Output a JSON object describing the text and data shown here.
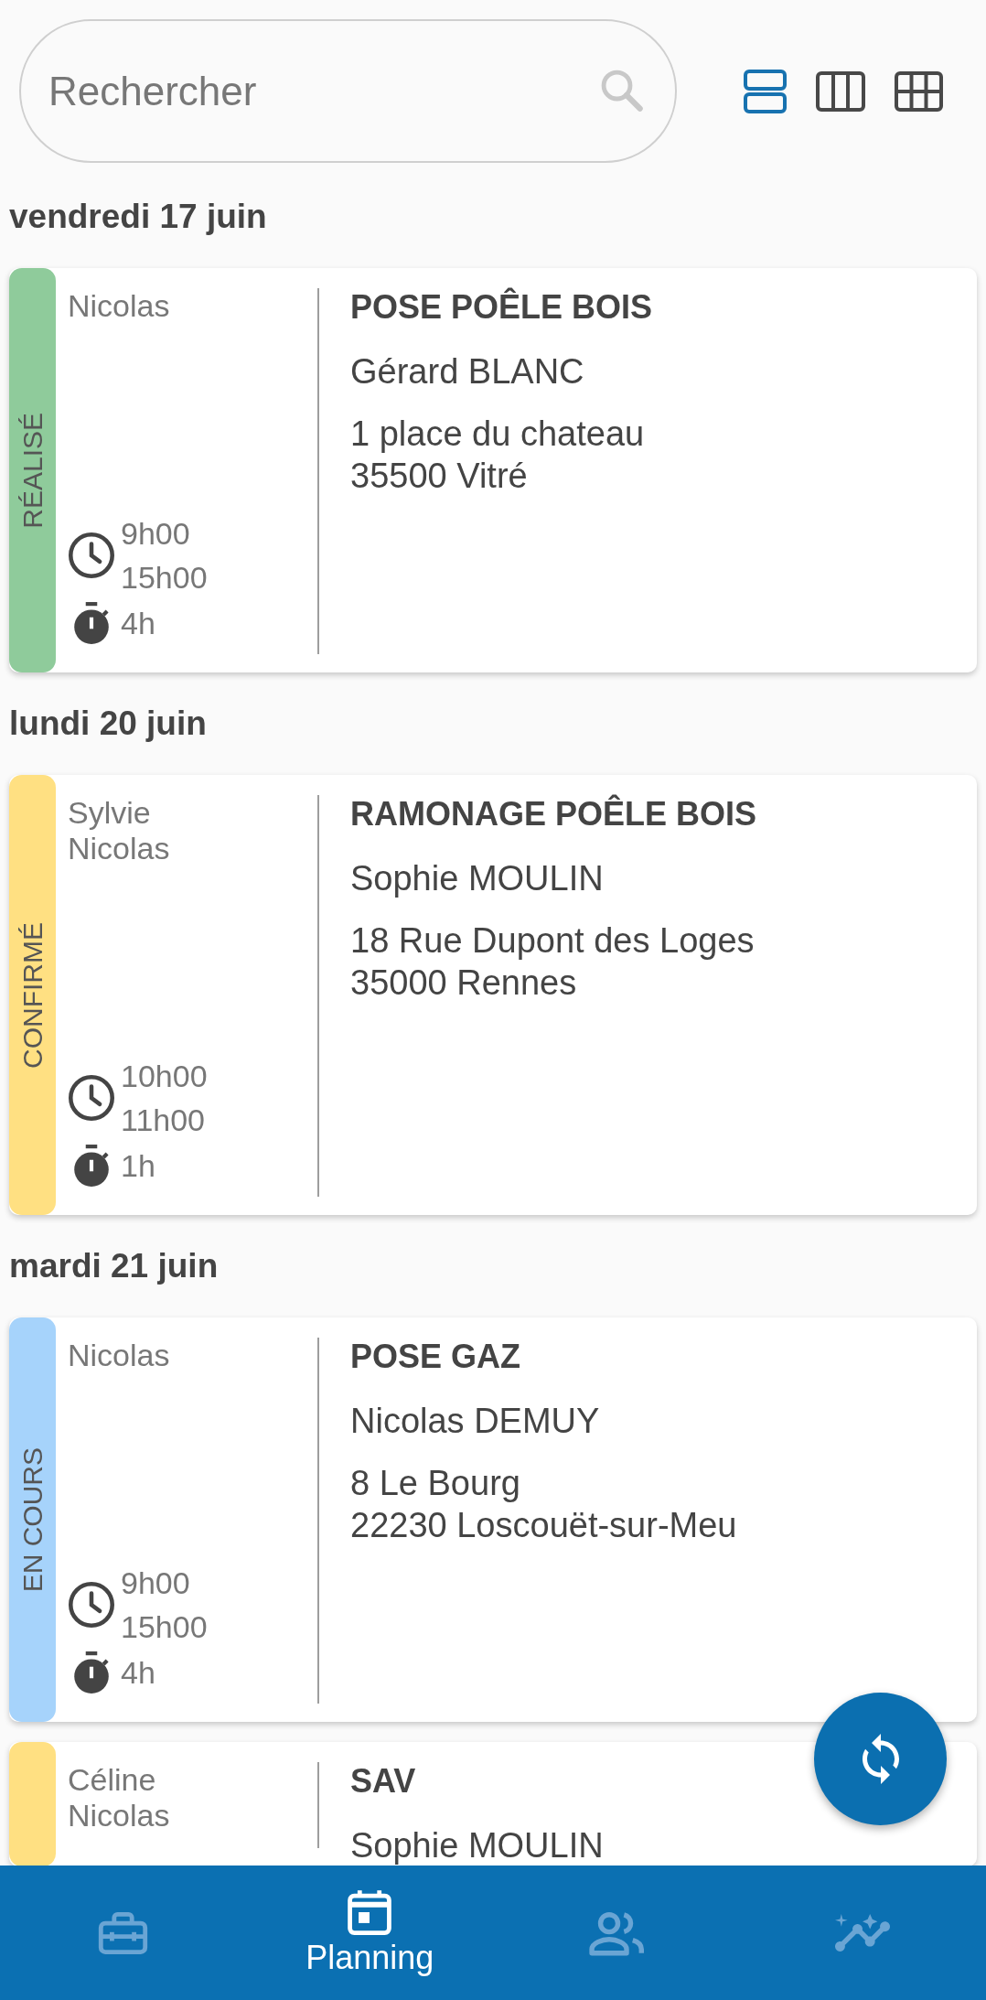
{
  "search": {
    "placeholder": "Rechercher"
  },
  "view_modes": [
    {
      "kind": "list",
      "selected": true
    },
    {
      "kind": "columns",
      "selected": false
    },
    {
      "kind": "grid",
      "selected": false
    }
  ],
  "days": [
    {
      "date": "vendredi 17 juin",
      "appointments": [
        {
          "status": {
            "label": "RÉALISÉ",
            "color": "#8fcb9b"
          },
          "technicians": [
            "Nicolas"
          ],
          "times": {
            "start": "9h00",
            "end": "15h00",
            "duration": "4h"
          },
          "title": "POSE POÊLE BOIS",
          "client": "Gérard BLANC",
          "address": [
            "1 place du chateau",
            "35500 Vitré"
          ]
        }
      ]
    },
    {
      "date": "lundi 20 juin",
      "appointments": [
        {
          "status": {
            "label": "CONFIRMÉ",
            "color": "#ffe082"
          },
          "technicians": [
            "Sylvie",
            "Nicolas"
          ],
          "times": {
            "start": "10h00",
            "end": "11h00",
            "duration": "1h"
          },
          "title": "RAMONAGE POÊLE BOIS",
          "client": "Sophie MOULIN",
          "address": [
            "18 Rue Dupont des Loges",
            "35000 Rennes"
          ]
        }
      ]
    },
    {
      "date": "mardi 21 juin",
      "appointments": [
        {
          "status": {
            "label": "EN COURS",
            "color": "#a6d3fb"
          },
          "technicians": [
            "Nicolas"
          ],
          "times": {
            "start": "9h00",
            "end": "15h00",
            "duration": "4h"
          },
          "title": "POSE GAZ",
          "client": "Nicolas DEMUY",
          "address": [
            "8 Le Bourg",
            "22230 Loscouët-sur-Meu"
          ]
        },
        {
          "status": {
            "color": "#ffe082"
          },
          "technicians": [
            "Céline",
            "Nicolas"
          ],
          "title": "SAV",
          "client": "Sophie MOULIN"
        }
      ]
    }
  ],
  "bottom_nav": [
    {
      "kind": "toolbox",
      "selected": false
    },
    {
      "kind": "calendar",
      "label": "Planning",
      "selected": true
    },
    {
      "kind": "people",
      "selected": false
    },
    {
      "kind": "analytics",
      "selected": false
    }
  ]
}
